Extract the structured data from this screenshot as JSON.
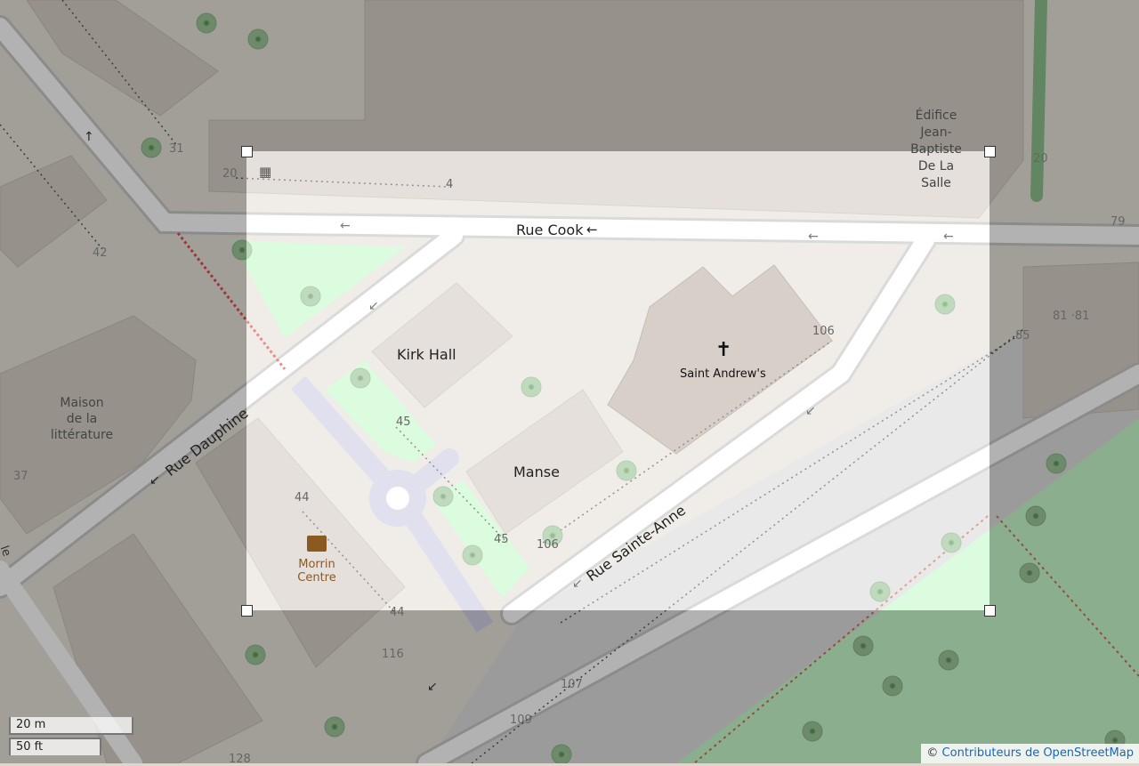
{
  "map": {
    "buildings": {
      "kirk_hall": "Kirk Hall",
      "manse": "Manse",
      "maison": [
        "Maison",
        "de la",
        "littérature"
      ],
      "edifice": [
        "Édifice",
        "Jean-",
        "Baptiste",
        "De La",
        "Salle"
      ]
    },
    "places": {
      "church_name": "Saint Andrew's",
      "morrin": [
        "Morrin",
        "Centre"
      ]
    },
    "roads": {
      "rue_cook": "Rue Cook",
      "rue_dauphine": "Rue Dauphine",
      "rue_sainte_anne": "Rue Sainte-Anne"
    },
    "addresses": {
      "a31": "31",
      "a20a": "20",
      "a4": "4",
      "a42": "42",
      "a37": "37",
      "a20b": "20",
      "a79": "79",
      "a81": "81 ·81",
      "a85": "85",
      "a106a": "106",
      "a106b": "106",
      "a45a": "45",
      "a45b": "45",
      "a44a": "44",
      "a44b": "44",
      "a116": "116",
      "a107": "107",
      "a109": "109",
      "a128": "128"
    },
    "edge_label": "le"
  },
  "scale": {
    "metric": "20 m",
    "imperial": "50 ft"
  },
  "attribution": {
    "symbol": "©",
    "text": "Contributeurs de OpenStreetMap"
  },
  "colors": {
    "background": "#dcd6cd",
    "building": "#d9d0c9",
    "church": "#c4b6ab",
    "park": "#c8facc",
    "road": "#ffffff",
    "dim_overlay": "rgba(0,0,0,0.30)",
    "tree": "#9dc79a"
  }
}
